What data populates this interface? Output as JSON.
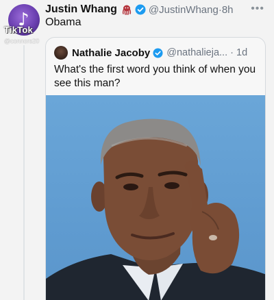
{
  "tweet": {
    "author_name": "Justin Whang",
    "author_emoji_icon": "octopus-icon",
    "handle": "@JustinWhang",
    "separator": "·",
    "time": "8h",
    "text": "Obama",
    "more_icon": "more-dots-icon"
  },
  "quoted_tweet": {
    "author_name": "Nathalie Jacoby",
    "handle": "@nathalieja...",
    "separator": "·",
    "time": "1d",
    "text": "What's the first word you think of when you see this man?"
  },
  "watermark": {
    "wordmark": "TikTok",
    "username": "@connors20"
  },
  "colors": {
    "verified_blue": "#1d9bf0",
    "handle_gray": "#6b7480",
    "photo_background": "#5f9bd0",
    "octopus_red": "#b4343c"
  }
}
